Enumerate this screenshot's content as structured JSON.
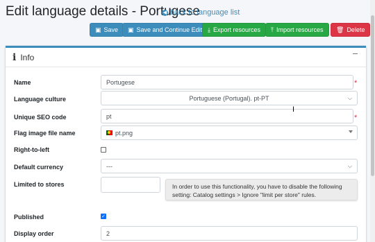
{
  "header": {
    "title": "Edit language details - Portugese",
    "back_link": "back to language list"
  },
  "toolbar": {
    "save": "Save",
    "save_continue": "Save and Continue Edit",
    "export": "Export resources",
    "import": "Import resources",
    "delete": "Delete"
  },
  "card": {
    "title": "Info"
  },
  "form": {
    "name_label": "Name",
    "name_value": "Portugese",
    "culture_label": "Language culture",
    "culture_value": "Portuguese (Portugal). pt-PT",
    "seo_label": "Unique SEO code",
    "seo_value": "pt",
    "flag_label": "Flag image file name",
    "flag_value": "pt.png",
    "rtl_label": "Right-to-left",
    "rtl_checked": false,
    "currency_label": "Default currency",
    "currency_value": "---",
    "stores_label": "Limited to stores",
    "stores_hint": "In order to use this functionality, you have to disable the following setting: Catalog settings > Ignore \"limit per store\" rules.",
    "published_label": "Published",
    "published_checked": true,
    "order_label": "Display order",
    "order_value": "2"
  },
  "colors": {
    "primary": "#3c8dbc",
    "success": "#28a745",
    "danger": "#dc3545"
  },
  "icons": {
    "back": "arrow-circle-left-icon",
    "save": "floppy-icon",
    "export": "download-icon",
    "import": "upload-icon",
    "delete": "trash-icon",
    "info": "info-icon",
    "collapse": "minus-icon"
  }
}
